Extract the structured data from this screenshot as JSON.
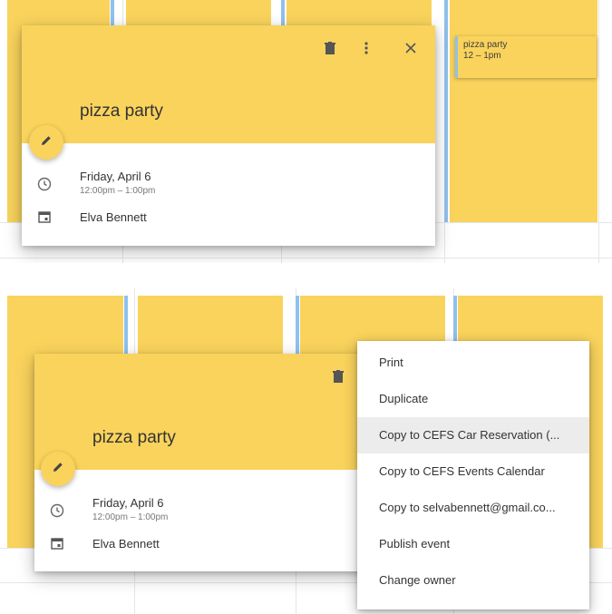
{
  "event": {
    "title": "pizza party",
    "date": "Friday, April 6",
    "time_range": "12:00pm – 1:00pm",
    "calendar_owner": "Elva Bennett"
  },
  "chip": {
    "title": "pizza party",
    "time": "12 – 1pm"
  },
  "menu": {
    "items": [
      "Print",
      "Duplicate",
      "Copy to CEFS Car Reservation (...",
      "Copy to CEFS Events Calendar",
      "Copy to selvabennett@gmail.co...",
      "Publish event",
      "Change owner"
    ],
    "highlighted_index": 2
  },
  "colors": {
    "event": "#f9d35c",
    "accent": "#8ec1ec",
    "grid": "#e6e6e6"
  },
  "icons": [
    "delete-icon",
    "more-vert-icon",
    "close-icon",
    "edit-pencil-icon",
    "clock-icon",
    "calendar-icon"
  ]
}
